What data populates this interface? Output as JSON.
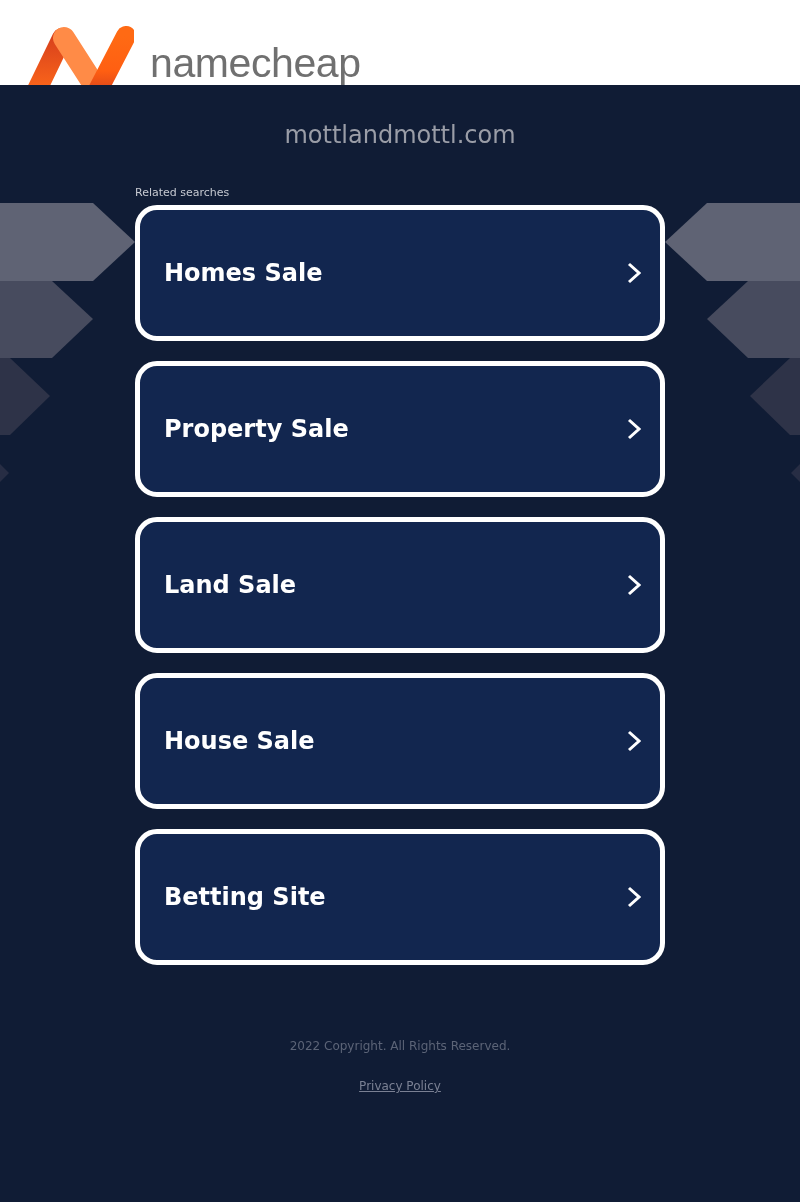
{
  "header": {
    "logo_text": "namecheap"
  },
  "domain": {
    "title": "mottlandmottl.com"
  },
  "related_searches": {
    "heading": "Related searches",
    "items": [
      {
        "label": "Homes Sale"
      },
      {
        "label": "Property Sale"
      },
      {
        "label": "Land Sale"
      },
      {
        "label": "House Sale"
      },
      {
        "label": "Betting Site"
      }
    ]
  },
  "footer": {
    "copyright": "2022 Copyright. All Rights Reserved.",
    "privacy_link": "Privacy Policy"
  }
}
